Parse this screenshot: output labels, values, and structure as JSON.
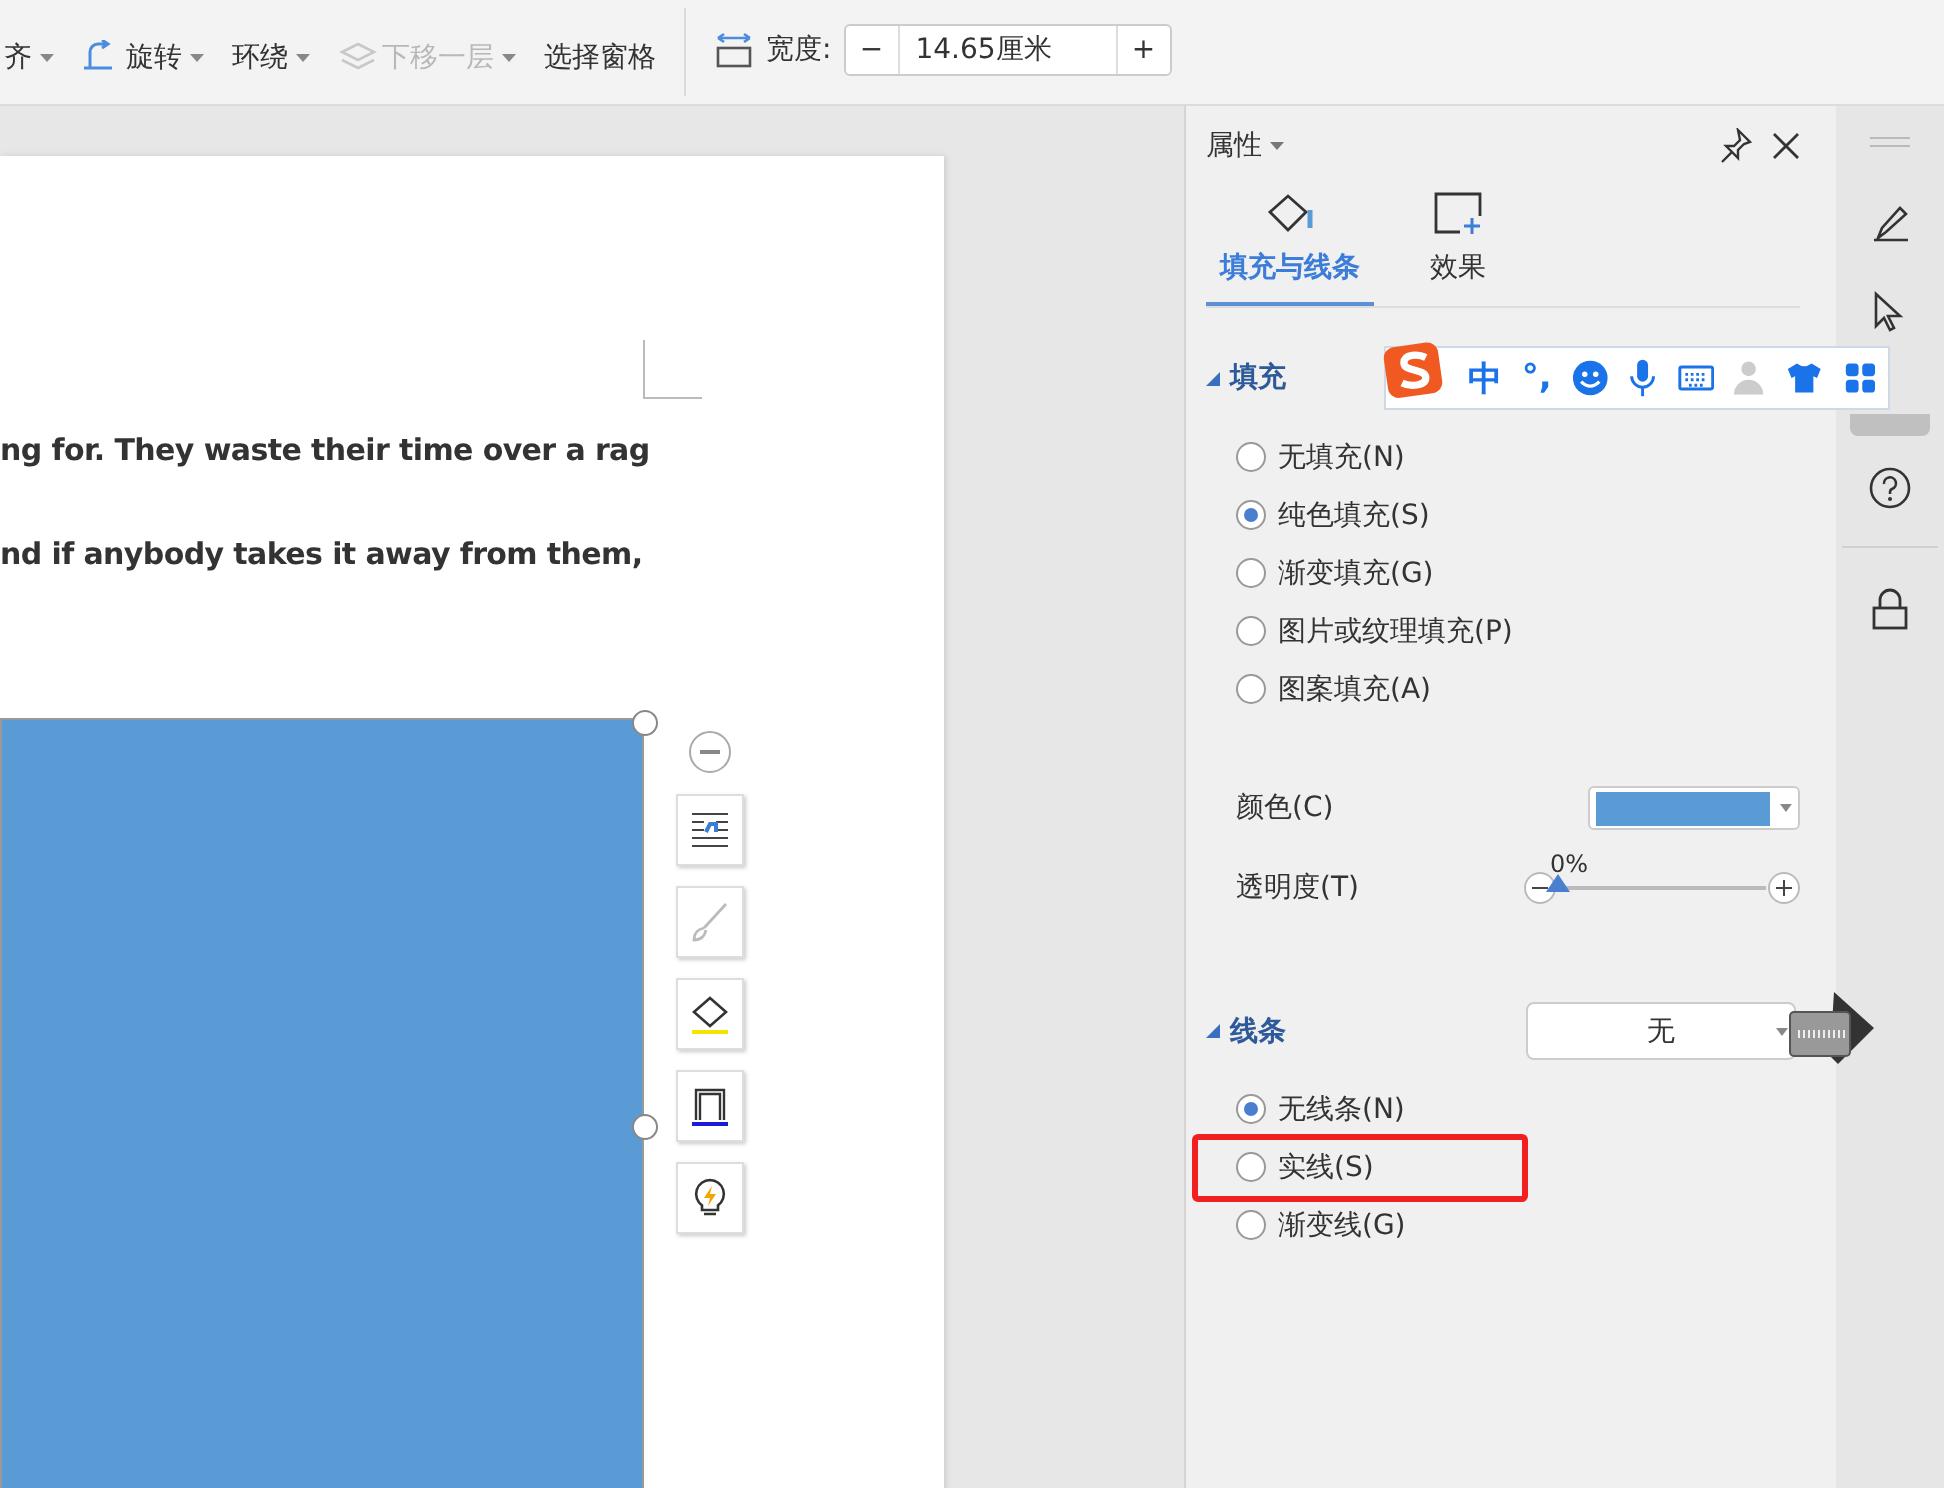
{
  "toolbar": {
    "items": [
      {
        "label": "齐",
        "disabled": false,
        "dropdown": true
      },
      {
        "label": "旋转",
        "disabled": false,
        "dropdown": true
      },
      {
        "label": "环绕",
        "disabled": false,
        "dropdown": true
      },
      {
        "label": "下移一层",
        "disabled": true,
        "dropdown": true
      },
      {
        "label": "选择窗格",
        "disabled": false,
        "dropdown": false
      }
    ],
    "width_field": {
      "label": "宽度:",
      "value": "14.65厘米",
      "minus": "−",
      "plus": "+"
    }
  },
  "document": {
    "lines": [
      "ng for. They waste their time over a rag",
      "nd if anybody takes it away from them,"
    ]
  },
  "panel": {
    "title": "属性",
    "tabs": [
      {
        "label": "填充与线条",
        "selected": true
      },
      {
        "label": "效果",
        "selected": false
      }
    ],
    "fill": {
      "title": "填充",
      "options": [
        {
          "label": "无填充(N)",
          "selected": false
        },
        {
          "label": "纯色填充(S)",
          "selected": true
        },
        {
          "label": "渐变填充(G)",
          "selected": false
        },
        {
          "label": "图片或纹理填充(P)",
          "selected": false
        },
        {
          "label": "图案填充(A)",
          "selected": false
        }
      ],
      "color": {
        "label": "颜色(C)",
        "color": "#5b9bd5"
      },
      "transparency": {
        "label": "透明度(T)",
        "reading": "0%",
        "level": 0
      }
    },
    "line": {
      "title": "线条",
      "value": "无",
      "options": [
        {
          "label": "无线条(N)",
          "selected": true
        },
        {
          "label": "实线(S)",
          "selected": false
        },
        {
          "label": "渐变线(G)",
          "selected": false
        }
      ]
    }
  },
  "ime_bar": {
    "items": [
      "中",
      "°,"
    ]
  }
}
